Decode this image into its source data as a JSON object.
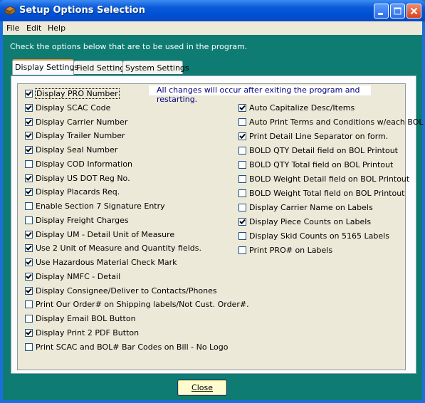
{
  "window": {
    "title": "Setup Options Selection"
  },
  "menu": [
    "File",
    "Edit",
    "Help"
  ],
  "instructions": "Check the options below that are to be used in the program.",
  "tabs": [
    "Display Settings",
    "Field Settings",
    "System Settings"
  ],
  "note": "All changes will occur after exiting the program and restarting.",
  "left_options": [
    {
      "label": "Display PRO Number",
      "checked": true
    },
    {
      "label": "Display SCAC Code",
      "checked": true
    },
    {
      "label": "Display Carrier Number",
      "checked": true
    },
    {
      "label": "Display Trailer Number",
      "checked": true
    },
    {
      "label": "Display Seal Number",
      "checked": true
    },
    {
      "label": "Display COD Information",
      "checked": false
    },
    {
      "label": "Display US DOT Reg No.",
      "checked": true
    },
    {
      "label": "Display Placards Req.",
      "checked": true
    },
    {
      "label": "Enable Section 7 Signature Entry",
      "checked": false
    },
    {
      "label": "Display Freight Charges",
      "checked": false
    },
    {
      "label": "Display UM - Detail Unit of Measure",
      "checked": true
    },
    {
      "label": "Use 2 Unit of Measure and Quantity fields.",
      "checked": true
    },
    {
      "label": "Use Hazardous Material Check Mark",
      "checked": true
    },
    {
      "label": "Display NMFC - Detail",
      "checked": true
    },
    {
      "label": "Display Consignee/Deliver to Contacts/Phones",
      "checked": true
    },
    {
      "label": "Print Our Order# on Shipping labels/Not Cust. Order#.",
      "checked": false
    },
    {
      "label": "Display Email BOL Button",
      "checked": false
    },
    {
      "label": "Display Print 2 PDF Button",
      "checked": true
    },
    {
      "label": "Print SCAC and BOL# Bar Codes on Bill - No Logo",
      "checked": false
    }
  ],
  "right_options": [
    {
      "label": "Auto Capitalize Desc/Items",
      "checked": true
    },
    {
      "label": "Auto Print Terms and Conditions w/each BOL",
      "checked": false
    },
    {
      "label": "Print Detail Line Separator on form.",
      "checked": true
    },
    {
      "label": "BOLD QTY Detail field on BOL Printout",
      "checked": false
    },
    {
      "label": "BOLD QTY Total field on BOL Printout",
      "checked": false
    },
    {
      "label": "BOLD Weight Detail field on BOL Printout",
      "checked": false
    },
    {
      "label": "BOLD Weight Total field on BOL Printout",
      "checked": false
    },
    {
      "label": "Display Carrier Name on Labels",
      "checked": false
    },
    {
      "label": "Display Piece Counts on Labels",
      "checked": true
    },
    {
      "label": "Display Skid Counts on 5165 Labels",
      "checked": false
    },
    {
      "label": "Print PRO# on Labels",
      "checked": false
    }
  ],
  "close_button": "Close"
}
